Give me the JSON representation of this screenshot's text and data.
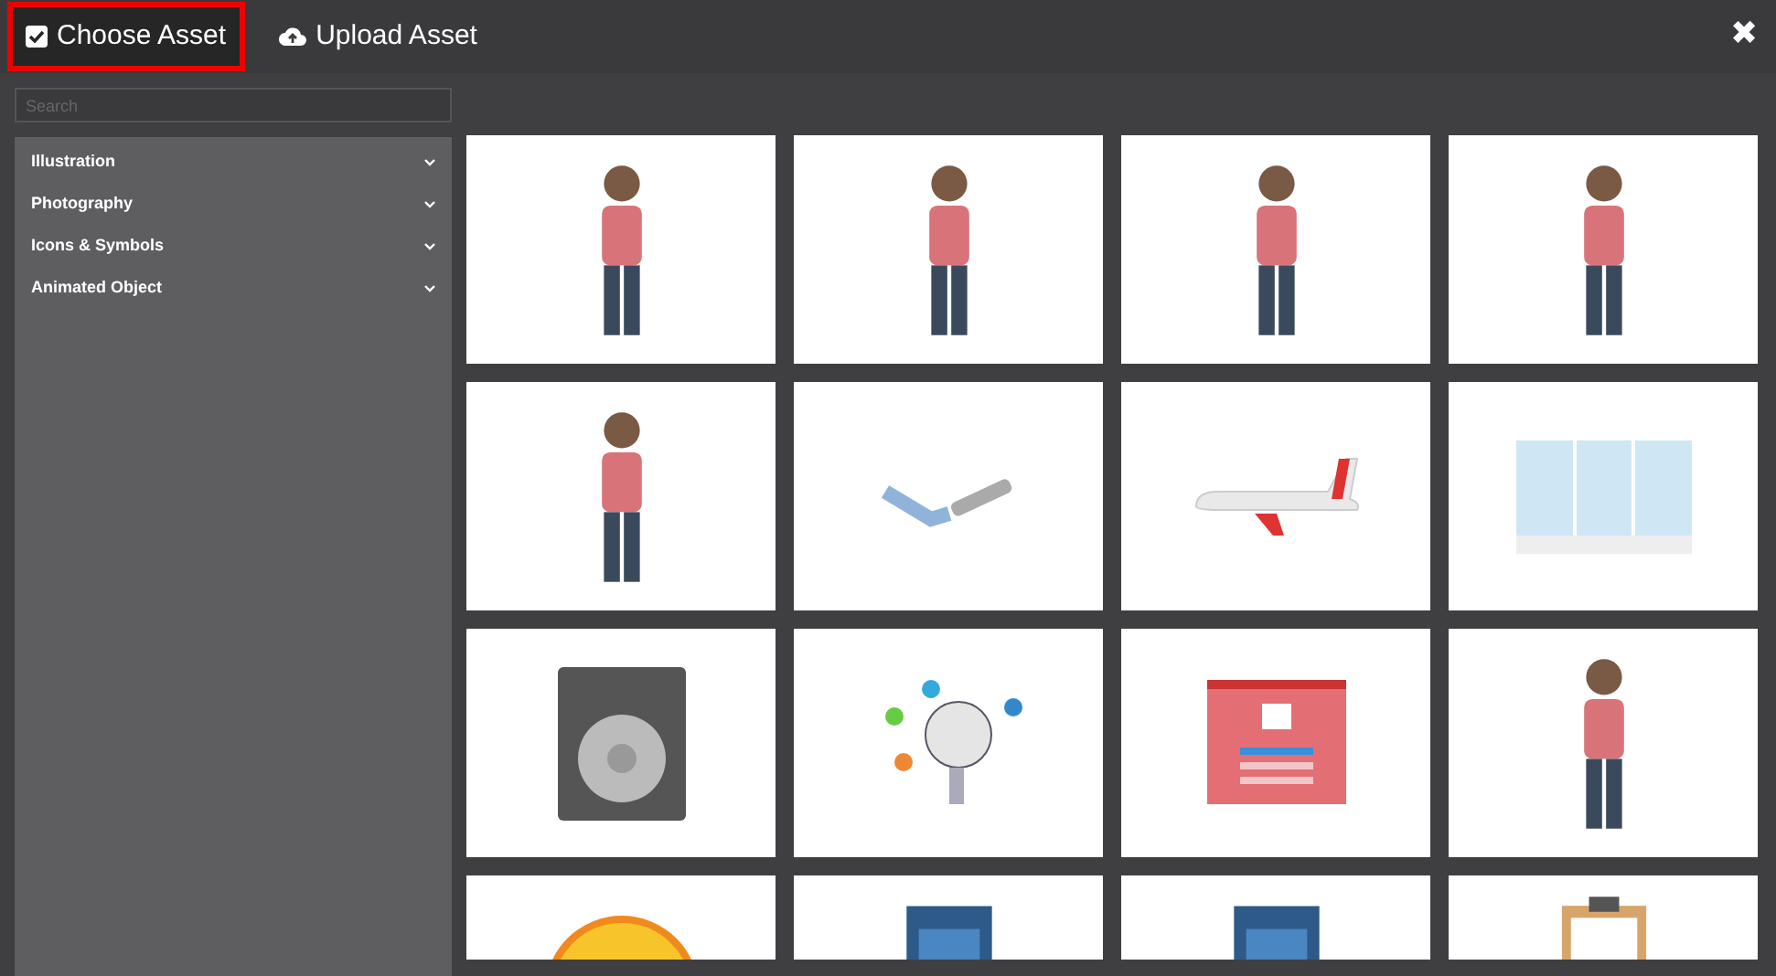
{
  "tabs": [
    {
      "label": "Choose Asset",
      "selected": true
    },
    {
      "label": "Upload Asset",
      "selected": false
    }
  ],
  "close": "✖",
  "search": {
    "placeholder": "Search"
  },
  "categories": [
    {
      "label": "Illustration",
      "expanded": false
    },
    {
      "label": "Photography",
      "expanded": false
    },
    {
      "label": "Icons & Symbols",
      "expanded": false
    },
    {
      "label": "Animated Object",
      "expanded": false
    }
  ],
  "assets": [
    {
      "kind": "person"
    },
    {
      "kind": "person"
    },
    {
      "kind": "person"
    },
    {
      "kind": "person"
    },
    {
      "kind": "person"
    },
    {
      "kind": "hand"
    },
    {
      "kind": "airplane"
    },
    {
      "kind": "window"
    },
    {
      "kind": "amplifier"
    },
    {
      "kind": "robot"
    },
    {
      "kind": "app-screen"
    },
    {
      "kind": "person"
    },
    {
      "kind": "sun"
    },
    {
      "kind": "device"
    },
    {
      "kind": "device"
    },
    {
      "kind": "clipboard"
    }
  ]
}
